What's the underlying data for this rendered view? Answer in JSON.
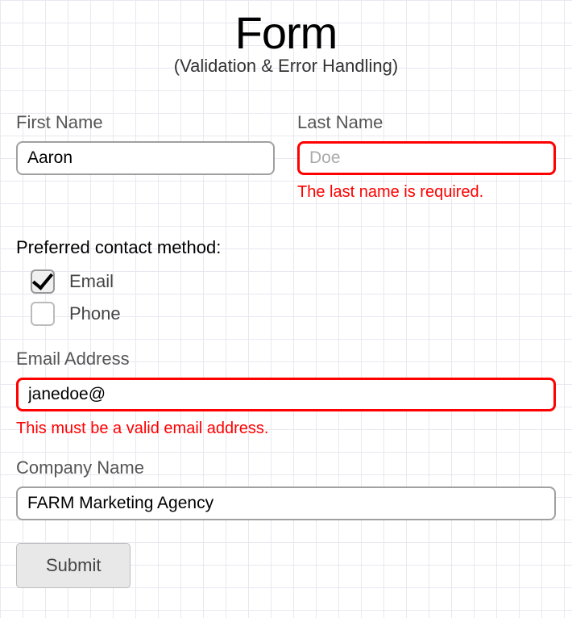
{
  "header": {
    "title": "Form",
    "subtitle": "(Validation & Error Handling)"
  },
  "fields": {
    "firstName": {
      "label": "First Name",
      "value": "Aaron"
    },
    "lastName": {
      "label": "Last Name",
      "placeholder": "Doe",
      "error": "The last name is required."
    },
    "contactMethod": {
      "label": "Preferred contact method:",
      "options": [
        {
          "label": "Email",
          "checked": true
        },
        {
          "label": "Phone",
          "checked": false
        }
      ]
    },
    "email": {
      "label": "Email Address",
      "value": "janedoe@",
      "error": "This must be a valid email address."
    },
    "company": {
      "label": "Company Name",
      "value": "FARM Marketing Agency"
    }
  },
  "buttons": {
    "submit": "Submit"
  }
}
